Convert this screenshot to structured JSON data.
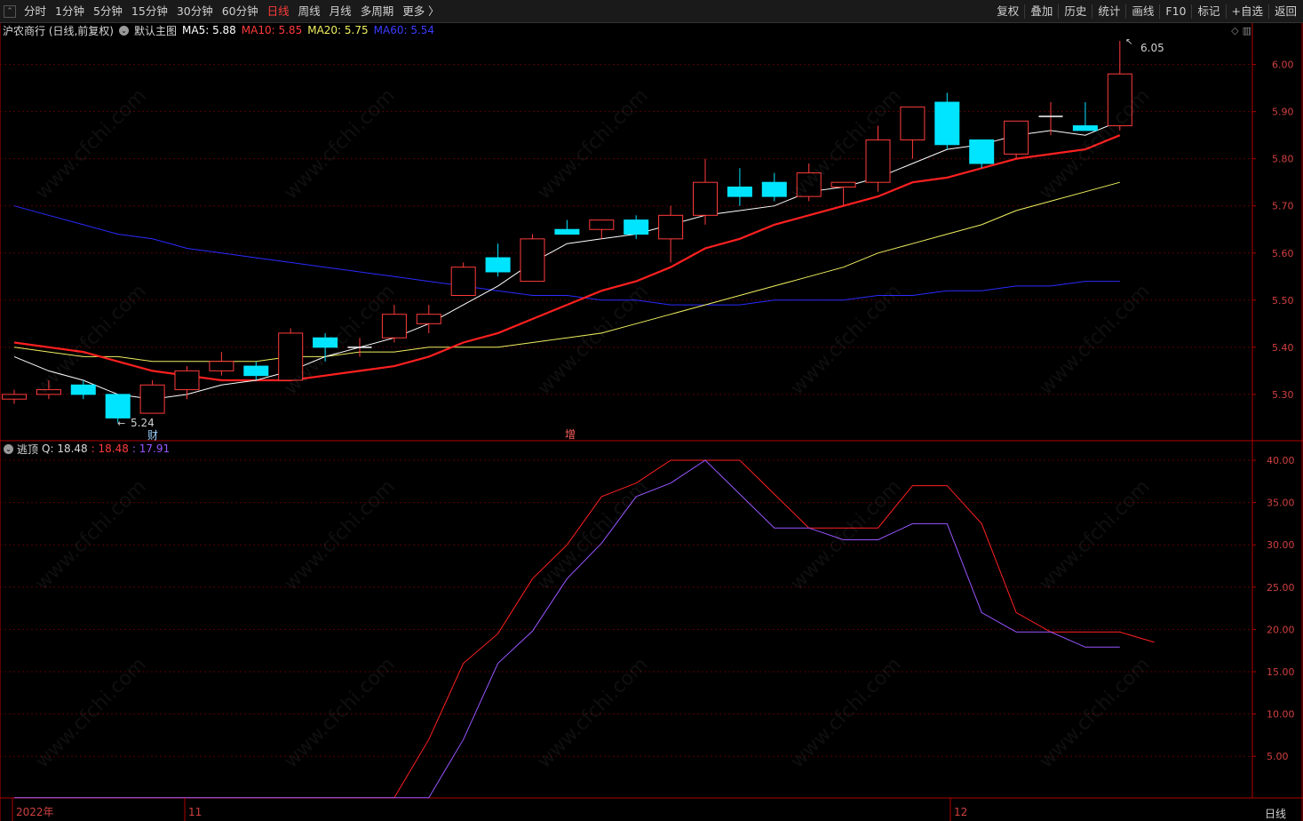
{
  "toolbar": {
    "left": [
      {
        "label": "分时",
        "active": false
      },
      {
        "label": "1分钟",
        "active": false
      },
      {
        "label": "5分钟",
        "active": false
      },
      {
        "label": "15分钟",
        "active": false
      },
      {
        "label": "30分钟",
        "active": false
      },
      {
        "label": "60分钟",
        "active": false
      },
      {
        "label": "日线",
        "active": true
      },
      {
        "label": "周线",
        "active": false
      },
      {
        "label": "月线",
        "active": false
      },
      {
        "label": "多周期",
        "active": false
      },
      {
        "label": "更多 〉",
        "active": false
      }
    ],
    "right": [
      "复权",
      "叠加",
      "历史",
      "统计",
      "画线",
      "F10",
      "标记",
      "+自选",
      "返回"
    ]
  },
  "main_header": {
    "stock": "沪农商行 (日线,前复权)",
    "template": "默认主图",
    "ma5": "MA5: 5.88",
    "ma10": "MA10: 5.85",
    "ma20": "MA20: 5.75",
    "ma60": "MA60: 5.54"
  },
  "sub_header": {
    "name": "逃顶",
    "q_label": "Q: 18.48",
    "v1": ": 18.48",
    "v2": ": 17.91"
  },
  "annotations": {
    "high": "6.05",
    "low": "5.24",
    "event_cai": "财",
    "event_zeng": "增"
  },
  "watermark": "www.cfchi.com",
  "period_label": "日线",
  "colors": {
    "up": "#ff3b3b",
    "down": "#00e5ff",
    "ma5": "#ffffff",
    "ma10": "#ff2020",
    "ma20": "#f0f060",
    "ma60": "#2a2aff",
    "q1": "#ff2020",
    "q2": "#9955ff",
    "axis": "#b00000"
  },
  "chart_data": [
    {
      "type": "candlestick",
      "title": "沪农商行 (日线,前复权)",
      "ylim": [
        5.2,
        6.1
      ],
      "y_ticks": [
        5.3,
        5.4,
        5.5,
        5.6,
        5.7,
        5.8,
        5.9,
        6.0
      ],
      "x_labels": [
        "2022年",
        "11",
        "12"
      ],
      "candles": [
        {
          "o": 5.29,
          "c": 5.3,
          "h": 5.31,
          "l": 5.28
        },
        {
          "o": 5.3,
          "c": 5.31,
          "h": 5.33,
          "l": 5.29
        },
        {
          "o": 5.32,
          "c": 5.3,
          "h": 5.33,
          "l": 5.29
        },
        {
          "o": 5.3,
          "c": 5.25,
          "h": 5.3,
          "l": 5.24
        },
        {
          "o": 5.26,
          "c": 5.32,
          "h": 5.33,
          "l": 5.26
        },
        {
          "o": 5.31,
          "c": 5.35,
          "h": 5.36,
          "l": 5.29
        },
        {
          "o": 5.35,
          "c": 5.37,
          "h": 5.39,
          "l": 5.34
        },
        {
          "o": 5.36,
          "c": 5.34,
          "h": 5.37,
          "l": 5.33
        },
        {
          "o": 5.33,
          "c": 5.43,
          "h": 5.44,
          "l": 5.33
        },
        {
          "o": 5.42,
          "c": 5.4,
          "h": 5.43,
          "l": 5.37
        },
        {
          "o": 5.4,
          "c": 5.4,
          "h": 5.42,
          "l": 5.38
        },
        {
          "o": 5.42,
          "c": 5.47,
          "h": 5.49,
          "l": 5.41
        },
        {
          "o": 5.45,
          "c": 5.47,
          "h": 5.49,
          "l": 5.43
        },
        {
          "o": 5.51,
          "c": 5.57,
          "h": 5.58,
          "l": 5.51
        },
        {
          "o": 5.59,
          "c": 5.56,
          "h": 5.62,
          "l": 5.55
        },
        {
          "o": 5.54,
          "c": 5.63,
          "h": 5.64,
          "l": 5.54
        },
        {
          "o": 5.65,
          "c": 5.64,
          "h": 5.67,
          "l": 5.64
        },
        {
          "o": 5.65,
          "c": 5.67,
          "h": 5.67,
          "l": 5.63
        },
        {
          "o": 5.67,
          "c": 5.64,
          "h": 5.68,
          "l": 5.63
        },
        {
          "o": 5.63,
          "c": 5.68,
          "h": 5.7,
          "l": 5.58
        },
        {
          "o": 5.68,
          "c": 5.75,
          "h": 5.8,
          "l": 5.66
        },
        {
          "o": 5.74,
          "c": 5.72,
          "h": 5.78,
          "l": 5.7
        },
        {
          "o": 5.75,
          "c": 5.72,
          "h": 5.77,
          "l": 5.71
        },
        {
          "o": 5.72,
          "c": 5.77,
          "h": 5.79,
          "l": 5.71
        },
        {
          "o": 5.74,
          "c": 5.75,
          "h": 5.75,
          "l": 5.7
        },
        {
          "o": 5.75,
          "c": 5.84,
          "h": 5.87,
          "l": 5.73
        },
        {
          "o": 5.84,
          "c": 5.91,
          "h": 5.91,
          "l": 5.8
        },
        {
          "o": 5.92,
          "c": 5.83,
          "h": 5.94,
          "l": 5.82
        },
        {
          "o": 5.84,
          "c": 5.79,
          "h": 5.84,
          "l": 5.78
        },
        {
          "o": 5.81,
          "c": 5.88,
          "h": 5.88,
          "l": 5.8
        },
        {
          "o": 5.89,
          "c": 5.89,
          "h": 5.92,
          "l": 5.85
        },
        {
          "o": 5.87,
          "c": 5.86,
          "h": 5.92,
          "l": 5.86
        },
        {
          "o": 5.87,
          "c": 5.98,
          "h": 6.05,
          "l": 5.86
        }
      ],
      "ma5": [
        5.38,
        5.35,
        5.33,
        5.3,
        5.29,
        5.3,
        5.32,
        5.33,
        5.35,
        5.38,
        5.4,
        5.42,
        5.45,
        5.49,
        5.53,
        5.58,
        5.62,
        5.63,
        5.64,
        5.66,
        5.68,
        5.69,
        5.7,
        5.73,
        5.74,
        5.76,
        5.79,
        5.82,
        5.83,
        5.85,
        5.86,
        5.85,
        5.88
      ],
      "ma10": [
        5.41,
        5.4,
        5.39,
        5.37,
        5.35,
        5.34,
        5.33,
        5.33,
        5.33,
        5.34,
        5.35,
        5.36,
        5.38,
        5.41,
        5.43,
        5.46,
        5.49,
        5.52,
        5.54,
        5.57,
        5.61,
        5.63,
        5.66,
        5.68,
        5.7,
        5.72,
        5.75,
        5.76,
        5.78,
        5.8,
        5.81,
        5.82,
        5.85
      ],
      "ma20": [
        5.4,
        5.39,
        5.38,
        5.38,
        5.37,
        5.37,
        5.37,
        5.37,
        5.38,
        5.38,
        5.39,
        5.39,
        5.4,
        5.4,
        5.4,
        5.41,
        5.42,
        5.43,
        5.45,
        5.47,
        5.49,
        5.51,
        5.53,
        5.55,
        5.57,
        5.6,
        5.62,
        5.64,
        5.66,
        5.69,
        5.71,
        5.73,
        5.75
      ],
      "ma60": [
        5.7,
        5.68,
        5.66,
        5.64,
        5.63,
        5.61,
        5.6,
        5.59,
        5.58,
        5.57,
        5.56,
        5.55,
        5.54,
        5.53,
        5.52,
        5.51,
        5.51,
        5.5,
        5.5,
        5.49,
        5.49,
        5.49,
        5.5,
        5.5,
        5.5,
        5.51,
        5.51,
        5.52,
        5.52,
        5.53,
        5.53,
        5.54,
        5.54
      ]
    },
    {
      "type": "line",
      "title": "逃顶",
      "ylim": [
        0,
        42
      ],
      "y_ticks": [
        5,
        10,
        15,
        20,
        25,
        30,
        35,
        40
      ],
      "series": [
        {
          "name": "Q",
          "values": [
            0.1,
            0.1,
            0.1,
            0.1,
            0.1,
            0.1,
            0.1,
            0.1,
            0.1,
            0.1,
            0.1,
            0.1,
            7,
            16,
            19.5,
            26,
            30,
            35.7,
            37.3,
            40,
            40,
            40,
            36,
            32,
            32,
            32,
            37,
            37,
            32.5,
            22,
            19.7,
            19.7,
            19.7,
            18.48
          ]
        },
        {
          "name": "",
          "values": [
            0.1,
            0.1,
            0.1,
            0.1,
            0.1,
            0.1,
            0.1,
            0.1,
            0.1,
            0.1,
            0.1,
            0.1,
            0.1,
            7,
            16,
            19.8,
            26,
            30.2,
            35.7,
            37.3,
            40,
            36,
            32,
            32,
            30.6,
            30.6,
            32.5,
            32.5,
            22,
            19.7,
            19.7,
            17.91,
            17.91
          ]
        }
      ]
    }
  ]
}
